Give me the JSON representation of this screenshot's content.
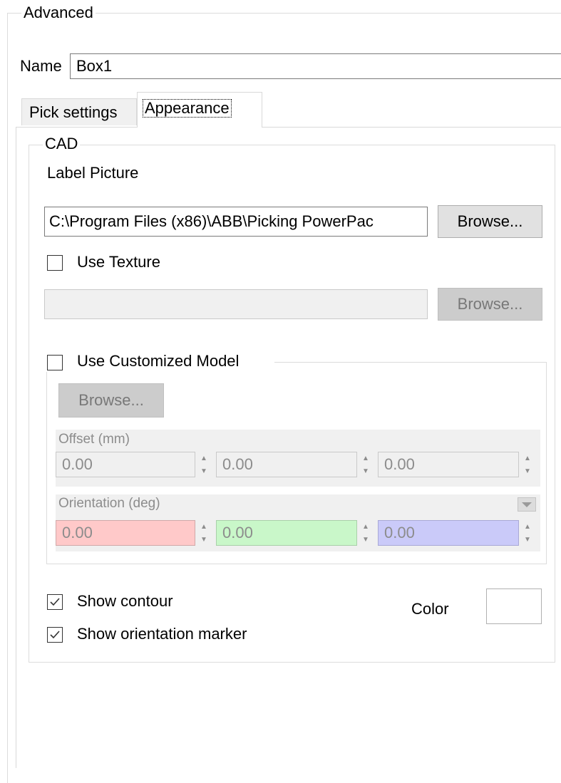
{
  "advanced_group": {
    "legend": "Advanced"
  },
  "name_field": {
    "label": "Name",
    "value": "Box1"
  },
  "tabs": [
    {
      "label": "Pick settings",
      "selected": false
    },
    {
      "label": "Appearance",
      "selected": true
    }
  ],
  "cad_group": {
    "legend": "CAD",
    "label_picture": {
      "label": "Label Picture",
      "path": "C:\\Program Files (x86)\\ABB\\Picking PowerPac",
      "browse_label": "Browse..."
    },
    "use_texture": {
      "label": "Use Texture",
      "checked": false,
      "path": "",
      "browse_label": "Browse..."
    },
    "customized_model": {
      "label": "Use Customized Model",
      "checked": false,
      "browse_label": "Browse...",
      "offset": {
        "label": "Offset (mm)",
        "values": [
          "0.00",
          "0.00",
          "0.00"
        ]
      },
      "orientation": {
        "label": "Orientation (deg)",
        "values": [
          "0.00",
          "0.00",
          "0.00"
        ]
      }
    },
    "show_contour": {
      "label": "Show contour",
      "checked": true
    },
    "show_orientation_marker": {
      "label": "Show orientation marker",
      "checked": true
    },
    "color": {
      "label": "Color",
      "value": "#ffffff"
    }
  },
  "colors": {
    "orientation_x_bg": "#ffc9c9",
    "orientation_y_bg": "#c9f7c9",
    "orientation_z_bg": "#cacaf9"
  }
}
